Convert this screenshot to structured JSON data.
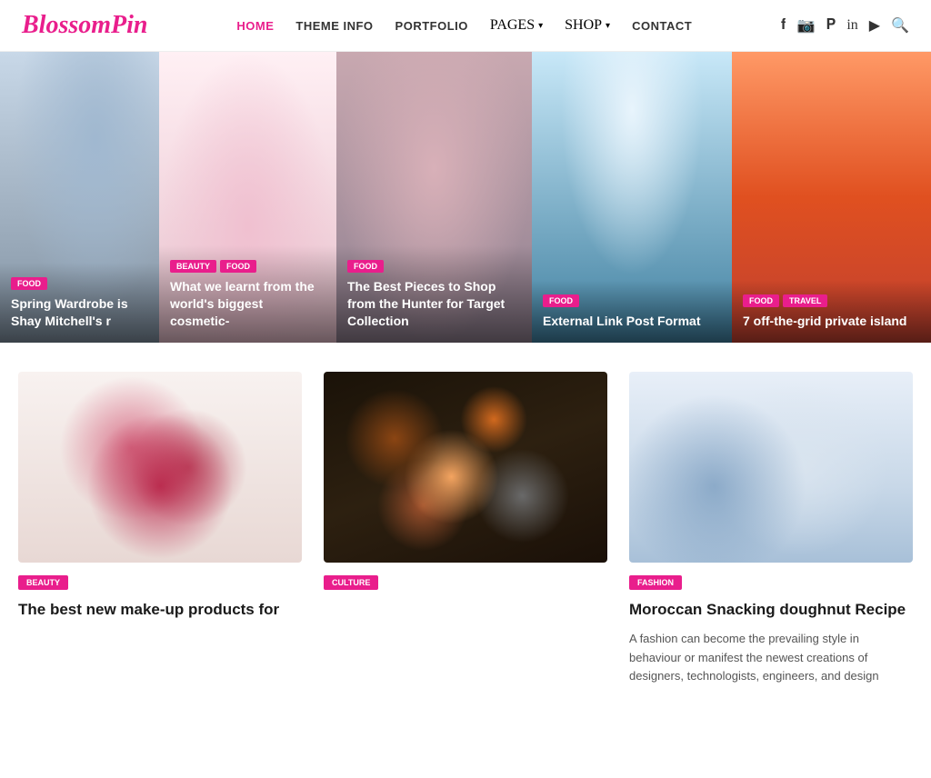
{
  "brand": {
    "name_black": "Blossom",
    "name_pink": "Pin"
  },
  "nav": {
    "items": [
      {
        "label": "HOME",
        "active": true,
        "has_dropdown": false
      },
      {
        "label": "THEME INFO",
        "active": false,
        "has_dropdown": false
      },
      {
        "label": "PORTFOLIO",
        "active": false,
        "has_dropdown": false
      },
      {
        "label": "PAGES",
        "active": false,
        "has_dropdown": true
      },
      {
        "label": "SHOP",
        "active": false,
        "has_dropdown": true
      },
      {
        "label": "CONTACT",
        "active": false,
        "has_dropdown": false
      }
    ]
  },
  "hero_slides": [
    {
      "tags": [
        "FOOD"
      ],
      "title": "Spring Wardrobe is Shay Mitchell's r",
      "img_class": "slide-1-figure"
    },
    {
      "tags": [
        "BEAUTY",
        "FOOD"
      ],
      "title": "What we learnt from the world's biggest cosmetic-",
      "img_class": "slide-2-figure"
    },
    {
      "tags": [
        "FOOD"
      ],
      "title": "The Best Pieces to Shop from the Hunter for Target Collection",
      "img_class": "slide-3-figure"
    },
    {
      "tags": [
        "FOOD"
      ],
      "title": "External Link Post Format",
      "img_class": "slide-4-figure"
    },
    {
      "tags": [
        "FOOD",
        "TRAVEL"
      ],
      "title": "7 off-the-grid private island",
      "img_class": "slide-5-figure"
    }
  ],
  "cards": [
    {
      "tag": "BEAUTY",
      "tag_class": "",
      "title": "The best new make-up products for",
      "excerpt": "",
      "img_class": "lipstick-img"
    },
    {
      "tag": "CULTURE",
      "tag_class": "culture",
      "title": "",
      "excerpt": "",
      "img_class": "spice-img"
    },
    {
      "tag": "FASHION",
      "tag_class": "fashion",
      "title": "Moroccan Snacking doughnut Recipe",
      "excerpt": "A fashion can become the prevailing style in behaviour or manifest the newest creations of designers, technologists, engineers, and design",
      "img_class": "winter-img"
    }
  ],
  "icons": {
    "facebook": "f",
    "instagram": "◻",
    "pinterest": "p",
    "linkedin": "in",
    "youtube": "▶",
    "search": "🔍"
  }
}
